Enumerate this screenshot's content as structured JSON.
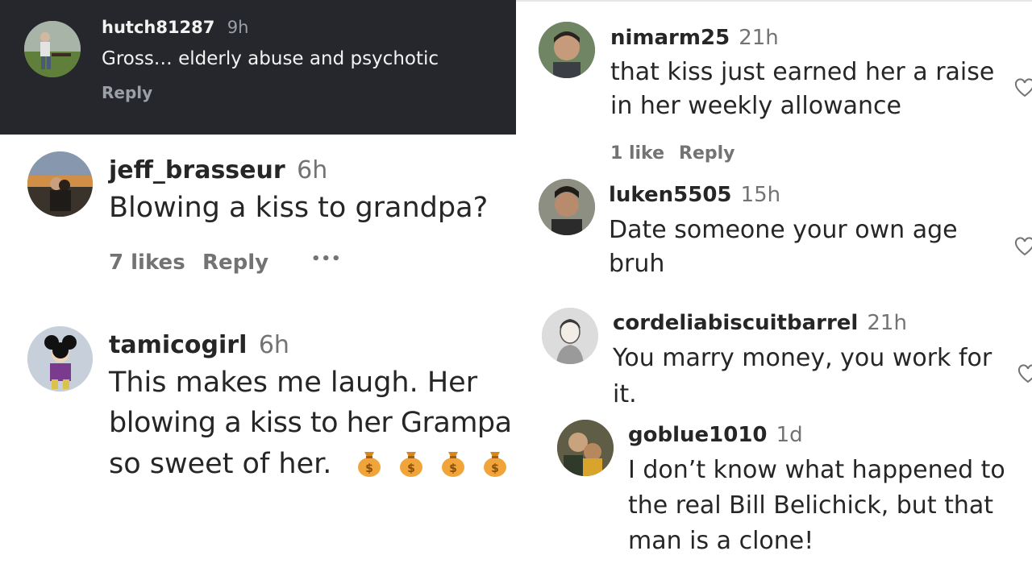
{
  "left_top_dark": {
    "username": "hutch81287",
    "time": "9h",
    "text": "Gross… elderly abuse and psychotic",
    "reply": "Reply"
  },
  "left_comments": [
    {
      "username": "jeff_brasseur",
      "time": "6h",
      "text": "Blowing a kiss to grandpa?",
      "likes": "7 likes",
      "reply": "Reply",
      "more": "•••"
    },
    {
      "username": "tamicogirl",
      "time": "6h",
      "lines": [
        "This makes me laugh. Her",
        "blowing a kiss to her Grampa",
        "so sweet of her."
      ],
      "emoji": "money-bag"
    }
  ],
  "right_comments": [
    {
      "username": "nimarm25",
      "time": "21h",
      "lines": [
        "that kiss just earned her a raise",
        "in her weekly allowance"
      ],
      "likes": "1 like",
      "reply": "Reply"
    },
    {
      "username": "luken5505",
      "time": "15h",
      "lines": [
        "Date someone your own age",
        "bruh"
      ]
    },
    {
      "username": "cordeliabiscuitbarrel",
      "time": "21h",
      "lines": [
        "You marry money, you work for",
        "it."
      ]
    },
    {
      "username": "goblue1010",
      "time": "1d",
      "lines": [
        "I don’t know what happened to",
        "the real Bill Belichick, but that",
        "man is a clone!"
      ]
    }
  ],
  "icons": {
    "like": "heart-outline-icon",
    "emoji": "money-bag-icon"
  }
}
